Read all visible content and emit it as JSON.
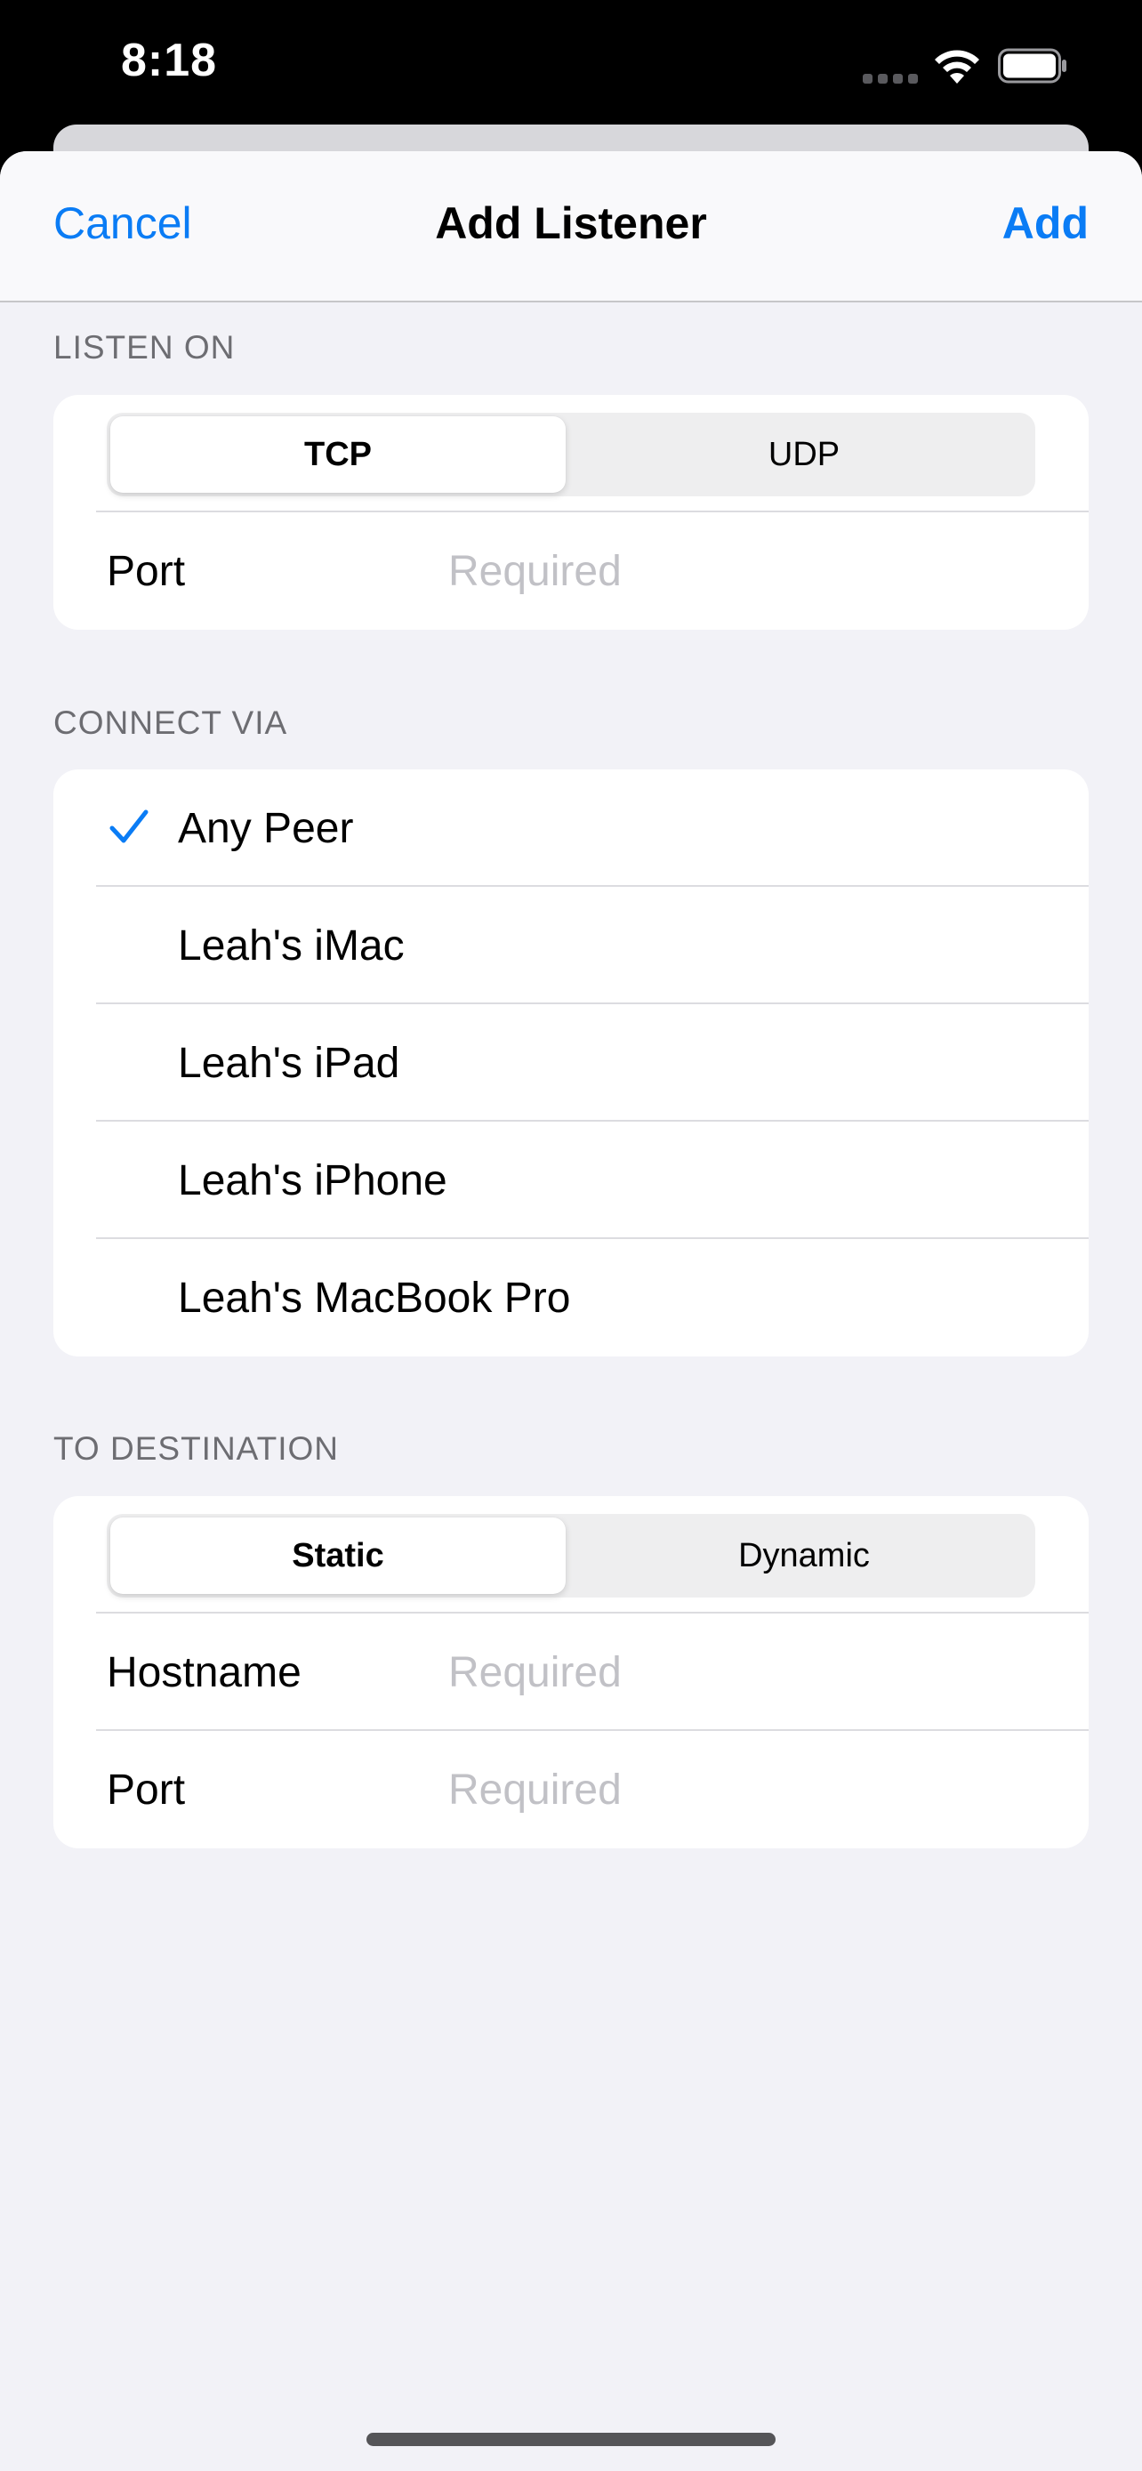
{
  "status_bar": {
    "time": "8:18"
  },
  "nav": {
    "cancel": "Cancel",
    "title": "Add Listener",
    "add": "Add"
  },
  "listen_on": {
    "header": "LISTEN ON",
    "segments": [
      "TCP",
      "UDP"
    ],
    "selected": "TCP",
    "port": {
      "label": "Port",
      "placeholder": "Required",
      "value": ""
    }
  },
  "connect_via": {
    "header": "CONNECT VIA",
    "items": [
      {
        "label": "Any Peer",
        "checked": true
      },
      {
        "label": "Leah's iMac",
        "checked": false
      },
      {
        "label": "Leah's iPad",
        "checked": false
      },
      {
        "label": "Leah's iPhone",
        "checked": false
      },
      {
        "label": "Leah's MacBook Pro",
        "checked": false
      }
    ]
  },
  "to_destination": {
    "header": "TO DESTINATION",
    "segments": [
      "Static",
      "Dynamic"
    ],
    "selected": "Static",
    "hostname": {
      "label": "Hostname",
      "placeholder": "Required",
      "value": ""
    },
    "port": {
      "label": "Port",
      "placeholder": "Required",
      "value": ""
    }
  },
  "colors": {
    "accent": "#0a7cf5",
    "background": "#f2f2f7",
    "placeholder": "#c1c1c6"
  }
}
